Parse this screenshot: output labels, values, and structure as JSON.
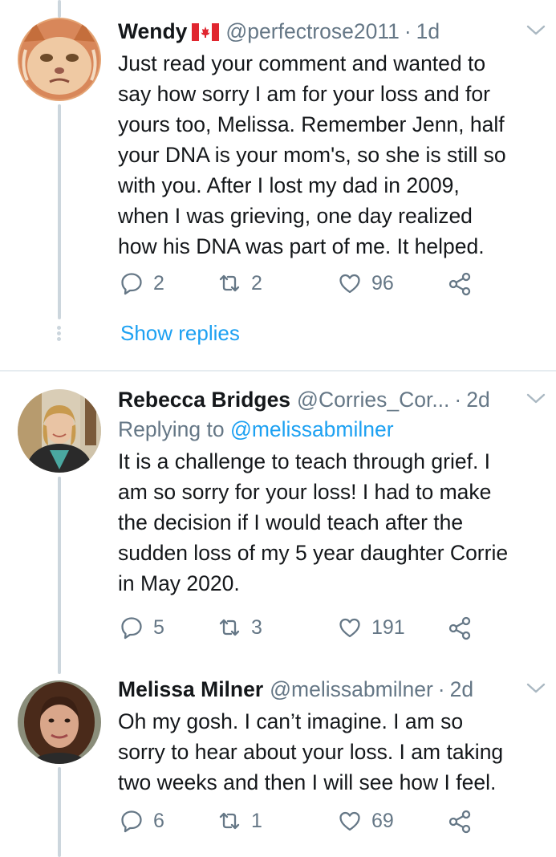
{
  "tweets": [
    {
      "name": "Wendy",
      "has_flag": true,
      "flag_icon": "canada-flag-icon",
      "handle": "@perfectrose2011",
      "time": "1d",
      "replying_to": null,
      "text_lines": [
        "Just read your comment and wanted to",
        "say how sorry I am for your loss and for",
        "yours too, Melissa. Remember Jenn, half",
        "your DNA is your mom's, so she is still so",
        "with you. After I lost my dad in 2009,",
        "when I was grieving, one day realized",
        "how his DNA was part of me. It helped."
      ],
      "replies": "2",
      "retweets": "2",
      "likes": "96"
    },
    {
      "name": "Rebecca Bridges",
      "handle": "@Corries_Cor...",
      "time": "2d",
      "replying_label": "Replying to",
      "replying_to": "@melissabmilner",
      "text_lines": [
        "It is a challenge to teach through grief.  I",
        "am so sorry for your loss! I had to make",
        "the decision if I would teach after the",
        "sudden loss of my 5 year daughter Corrie",
        "in May 2020."
      ],
      "replies": "5",
      "retweets": "3",
      "likes": "191"
    },
    {
      "name": "Melissa Milner",
      "handle": "@melissabmilner",
      "time": "2d",
      "replying_to": null,
      "text_lines": [
        "Oh my gosh. I can’t imagine. I am so",
        "sorry to hear about your loss. I am taking",
        "two weeks and then I will see how I feel."
      ],
      "replies": "6",
      "retweets": "1",
      "likes": "69"
    }
  ],
  "show_replies_label": "Show replies",
  "colors": {
    "accent": "#1da1f2",
    "muted": "#657786",
    "text": "#14171a",
    "thread_line": "#ccd6dd",
    "divider": "#e6ecf0"
  },
  "icons": [
    "reply-icon",
    "retweet-icon",
    "like-icon",
    "share-icon",
    "chevron-down-icon"
  ]
}
